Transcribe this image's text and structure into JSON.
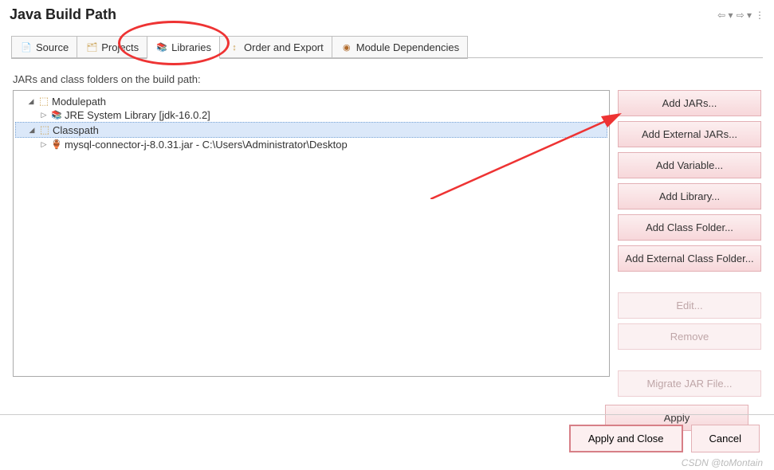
{
  "title": "Java Build Path",
  "tabs": {
    "source": "Source",
    "projects": "Projects",
    "libraries": "Libraries",
    "order": "Order and Export",
    "module": "Module Dependencies"
  },
  "desc": "JARs and class folders on the build path:",
  "tree": {
    "modulepath": "Modulepath",
    "jre": "JRE System Library [jdk-16.0.2]",
    "classpath": "Classpath",
    "mysql": "mysql-connector-j-8.0.31.jar - C:\\Users\\Administrator\\Desktop"
  },
  "buttons": {
    "addJars": "Add JARs...",
    "addExtJars": "Add External JARs...",
    "addVar": "Add Variable...",
    "addLib": "Add Library...",
    "addClassFolder": "Add Class Folder...",
    "addExtClassFolder": "Add External Class Folder...",
    "edit": "Edit...",
    "remove": "Remove",
    "migrate": "Migrate JAR File...",
    "apply": "Apply",
    "applyClose": "Apply and Close",
    "cancel": "Cancel"
  },
  "watermark": "CSDN @toMontain"
}
